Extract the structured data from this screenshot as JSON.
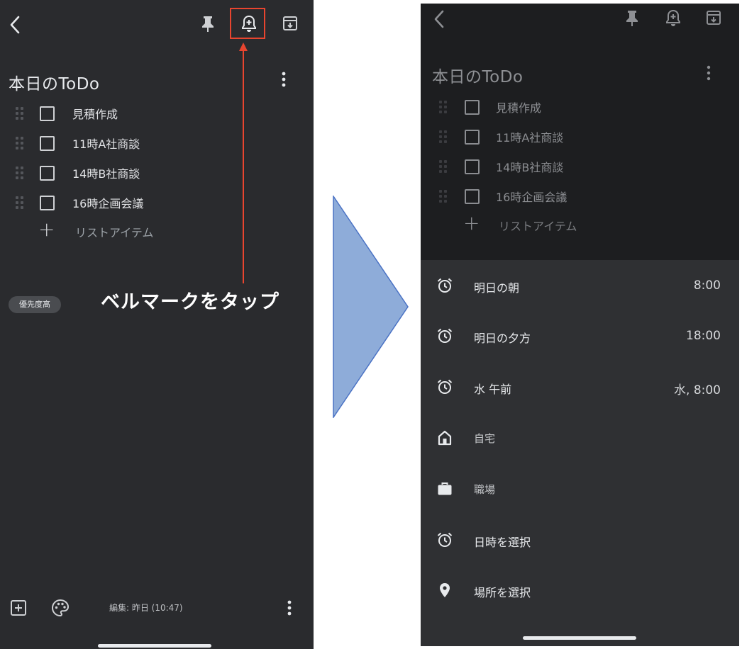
{
  "left_screen": {
    "title": "本日のToDo",
    "items": [
      {
        "label": "見積作成"
      },
      {
        "label": "11時A社商談"
      },
      {
        "label": "14時B社商談"
      },
      {
        "label": "16時企画会議"
      }
    ],
    "add_item_label": "リストアイテム",
    "label_chip": "優先度高",
    "edited": "編集: 昨日 (10:47)",
    "annotation": "ベルマークをタップ"
  },
  "right_screen": {
    "title": "本日のToDo",
    "items": [
      {
        "label": "見積作成"
      },
      {
        "label": "11時A社商談"
      },
      {
        "label": "14時B社商談"
      },
      {
        "label": "16時企画会議"
      }
    ],
    "add_item_label": "リストアイテム",
    "reminders": [
      {
        "label": "明日の朝",
        "time": "8:00",
        "icon": "alarm-icon"
      },
      {
        "label": "明日の夕方",
        "time": "18:00",
        "icon": "alarm-icon"
      },
      {
        "label": "水 午前",
        "time": "水, 8:00",
        "icon": "alarm-icon"
      },
      {
        "label": "自宅",
        "time": "",
        "icon": "home-icon"
      },
      {
        "label": "職場",
        "time": "",
        "icon": "briefcase-icon"
      },
      {
        "label": "日時を選択",
        "time": "",
        "icon": "alarm-icon"
      },
      {
        "label": "場所を選択",
        "time": "",
        "icon": "location-pin-icon"
      }
    ]
  },
  "colors": {
    "background": "#2a2b2e",
    "dim_overlay": "#1d1e20",
    "sheet": "#2f3033",
    "highlight": "#e8452f",
    "arrow_fill": "#8eacd9",
    "arrow_stroke": "#4a72c4"
  }
}
